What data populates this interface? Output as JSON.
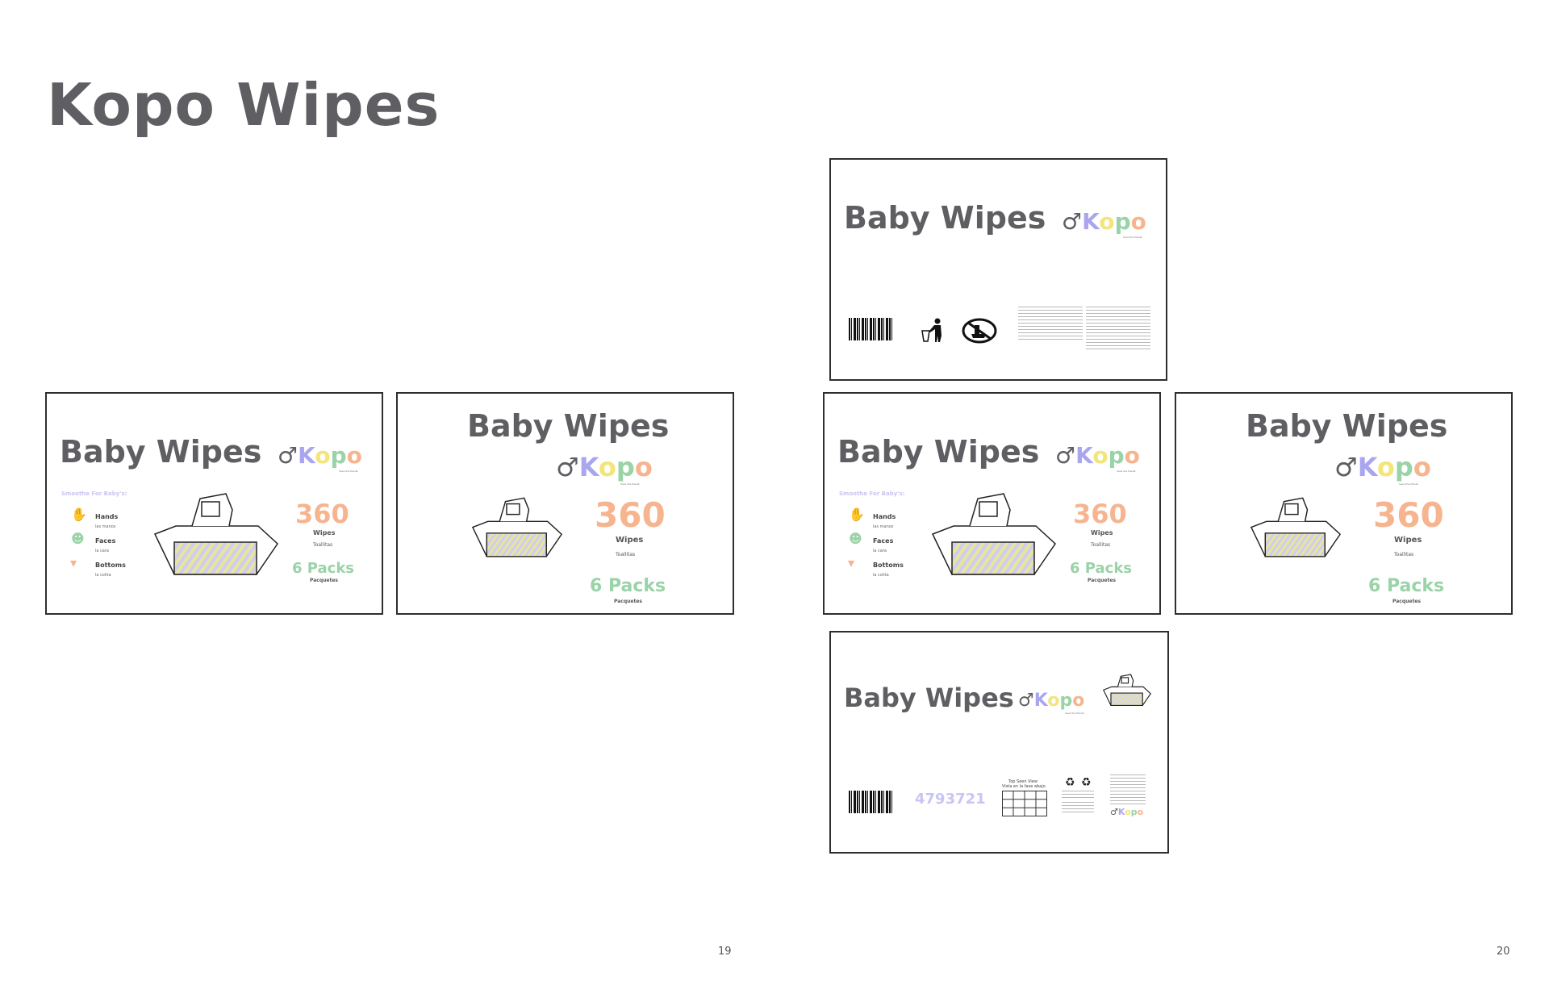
{
  "page": {
    "title": "Kopo Wipes",
    "page_left": "19",
    "page_right": "20"
  },
  "product": {
    "name": "Baby Wipes",
    "logo_letters": [
      "K",
      "o",
      "p",
      "o"
    ],
    "tagline": "Save the Planet",
    "count": "360",
    "count_label": "Wipes",
    "count_label_es": "Toallitas",
    "packs": "6 Packs",
    "packs_es": "Pacquetes",
    "upc": "4793721"
  },
  "side_panel": {
    "heading": "Smoothe For Baby's:",
    "items": [
      {
        "label": "Hands",
        "label_es": "las manos"
      },
      {
        "label": "Faces",
        "label_es": "la cara"
      },
      {
        "label": "Bottoms",
        "label_es": "la colita"
      }
    ]
  },
  "bottom_panel": {
    "top_view_title": "Top Seen View",
    "top_view_title_es": "Vista en la fase abajo"
  },
  "colors": {
    "text": "#5f5f63",
    "lavender": "#a9a6ef",
    "yellow": "#f2e57a",
    "green": "#9ad3a7",
    "peach": "#f6b48f",
    "border": "#2e2e2e"
  },
  "icons": [
    "trash-disposal-icon",
    "no-flush-icon",
    "hand-icon",
    "smiley-face-icon",
    "diaper-icon",
    "wipes-package-icon",
    "recycle-icon",
    "barcode-icon",
    "kopo-ring-icon"
  ]
}
